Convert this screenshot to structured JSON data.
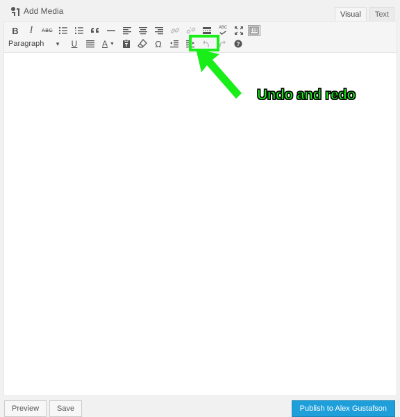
{
  "header": {
    "add_media_label": "Add Media",
    "tabs": [
      {
        "label": "Visual",
        "active": true
      },
      {
        "label": "Text",
        "active": false
      }
    ]
  },
  "toolbar": {
    "row1_icons": [
      "bold-icon",
      "italic-icon",
      "strikethrough-icon",
      "bulleted-list-icon",
      "numbered-list-icon",
      "blockquote-icon",
      "horizontal-line-icon",
      "align-left-icon",
      "align-center-icon",
      "align-right-icon",
      "insert-link-icon",
      "remove-link-icon",
      "read-more-icon",
      "spellcheck-icon",
      "fullscreen-icon",
      "toolbar-toggle-icon"
    ],
    "bold_glyph": "B",
    "italic_glyph": "I",
    "strikethrough_glyph": "ABC",
    "spellcheck_glyph": "ABC",
    "paragraph_select": "Paragraph",
    "row2_icons": [
      "underline-icon",
      "justify-icon",
      "text-color-icon",
      "paste-as-text-icon",
      "clear-formatting-icon",
      "special-character-icon",
      "outdent-icon",
      "indent-icon",
      "undo-icon",
      "redo-icon",
      "help-icon"
    ],
    "underline_glyph": "U",
    "textcolor_glyph": "A",
    "omega_glyph": "Ω"
  },
  "annotation": {
    "text": "Undo and redo",
    "color": "#19ee19"
  },
  "footer": {
    "preview_label": "Preview",
    "save_label": "Save",
    "publish_label": "Publish to Alex Gustafson",
    "publish_color": "#1e9fda"
  }
}
